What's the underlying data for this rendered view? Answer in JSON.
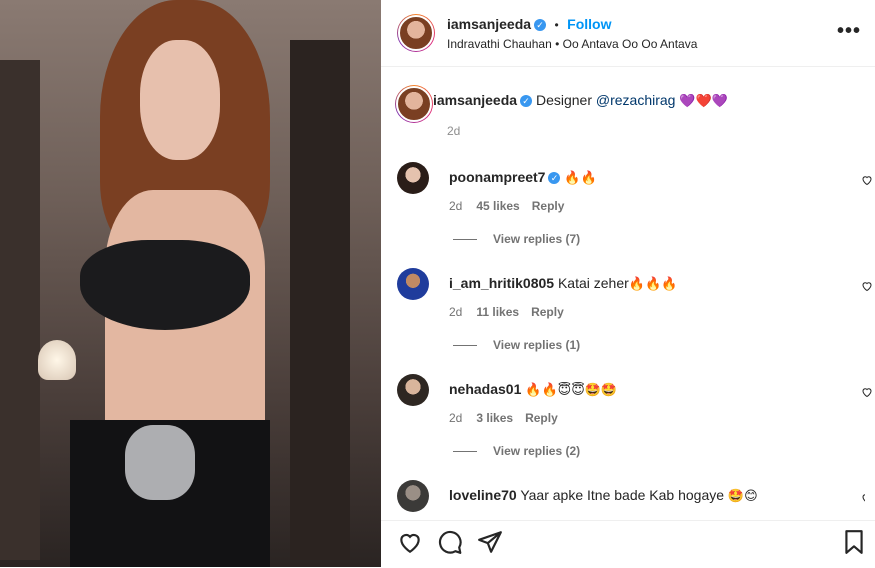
{
  "header": {
    "username": "iamsanjeeda",
    "separator": "•",
    "follow_label": "Follow",
    "audio_artist": "Indravathi Chauhan",
    "audio_sep": "•",
    "audio_track": "Oo Antava Oo Oo Antava",
    "more_label": "•••"
  },
  "caption": {
    "username": "iamsanjeeda",
    "text": "Designer ",
    "mention": "@rezachirag",
    "emojis": "💜❤️💜",
    "time": "2d"
  },
  "comments": [
    {
      "username": "poonampreet7",
      "verified": true,
      "text": "",
      "emojis": "🔥🔥",
      "time": "2d",
      "likes": "45 likes",
      "reply": "Reply",
      "replies": "View replies (7)"
    },
    {
      "username": "i_am_hritik0805",
      "verified": false,
      "text": "Katai zeher",
      "emojis": "🔥🔥🔥",
      "time": "2d",
      "likes": "11 likes",
      "reply": "Reply",
      "replies": "View replies (1)"
    },
    {
      "username": "nehadas01",
      "verified": false,
      "text": "",
      "emojis": "🔥🔥😇😇🤩🤩",
      "time": "2d",
      "likes": "3 likes",
      "reply": "Reply",
      "replies": "View replies (2)"
    },
    {
      "username": "loveline70",
      "verified": false,
      "text": "Yaar apke Itne bade Kab hogaye",
      "emojis": "🤩😊",
      "time": "",
      "likes": "",
      "reply": "",
      "replies": ""
    }
  ],
  "colors": {
    "accent": "#0095f6",
    "verified": "#3897f0",
    "mention": "#00376b"
  },
  "icons": [
    "heart-icon",
    "comment-icon",
    "share-icon",
    "bookmark-icon",
    "more-icon",
    "verified-icon"
  ]
}
